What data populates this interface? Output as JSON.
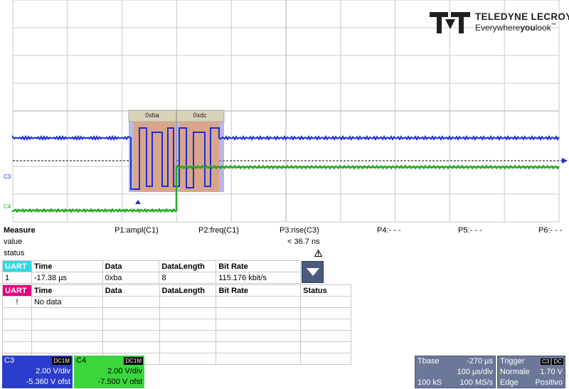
{
  "brand": {
    "name": "TELEDYNE LECROY",
    "tagline_pre": "Everywhere",
    "tagline_bold": "you",
    "tagline_post": "look",
    "tm": "™"
  },
  "channels": {
    "c3_marker": "C3",
    "c4_marker": "C4",
    "c3_color": "#1a2ed9",
    "c4_color": "#1faa1f"
  },
  "decode_overlay": {
    "bytes": [
      "0xba",
      "0xdc"
    ],
    "fill_color": "#d9a58a",
    "frame_color": "#7a7fd0"
  },
  "measure": {
    "title": "Measure",
    "row_value": "value",
    "row_status": "status",
    "params": [
      {
        "label": "P1:ampl(C1)",
        "value": "",
        "status": ""
      },
      {
        "label": "P2:freq(C1)",
        "value": "",
        "status": ""
      },
      {
        "label": "P3:rise(C3)",
        "value": "< 36.7 ns",
        "status": "warning-icon"
      },
      {
        "label": "P4:- - -",
        "value": "",
        "status": ""
      },
      {
        "label": "P5:- - -",
        "value": "",
        "status": ""
      },
      {
        "label": "P6:- - -",
        "value": "",
        "status": ""
      }
    ]
  },
  "uart1": {
    "tag": "UART",
    "headers": [
      "Time",
      "Data",
      "DataLength",
      "Bit Rate"
    ],
    "rows": [
      {
        "idx": "1",
        "time": "-17.38 µs",
        "data": "0xba",
        "length": "8",
        "rate": "115.176 kbit/s"
      }
    ]
  },
  "uart2": {
    "tag": "UART",
    "headers": [
      "Time",
      "Data",
      "DataLength",
      "Bit Rate",
      "Status"
    ],
    "rows": [
      {
        "idx": "!",
        "time": "No data",
        "data": "",
        "length": "",
        "rate": "",
        "status": ""
      }
    ]
  },
  "c3_desc": {
    "name": "C3",
    "coupling": "DC1M",
    "vdiv": "2.00 V/div",
    "offset": "-5.360 V ofst"
  },
  "c4_desc": {
    "name": "C4",
    "coupling": "DC1M",
    "vdiv": "2.00 V/div",
    "offset": "-7.500 V ofst"
  },
  "timebase": {
    "label": "Tbase",
    "delay": "-270 µs",
    "tdiv": "100 µs/div",
    "samples": "100 kS",
    "rate": "100 MS/s"
  },
  "trigger": {
    "label": "Trigger",
    "source": "C3",
    "coupling": "DC",
    "mode": "Normale",
    "level": "1.70 V",
    "type": "Edge",
    "slope": "Positivo"
  }
}
